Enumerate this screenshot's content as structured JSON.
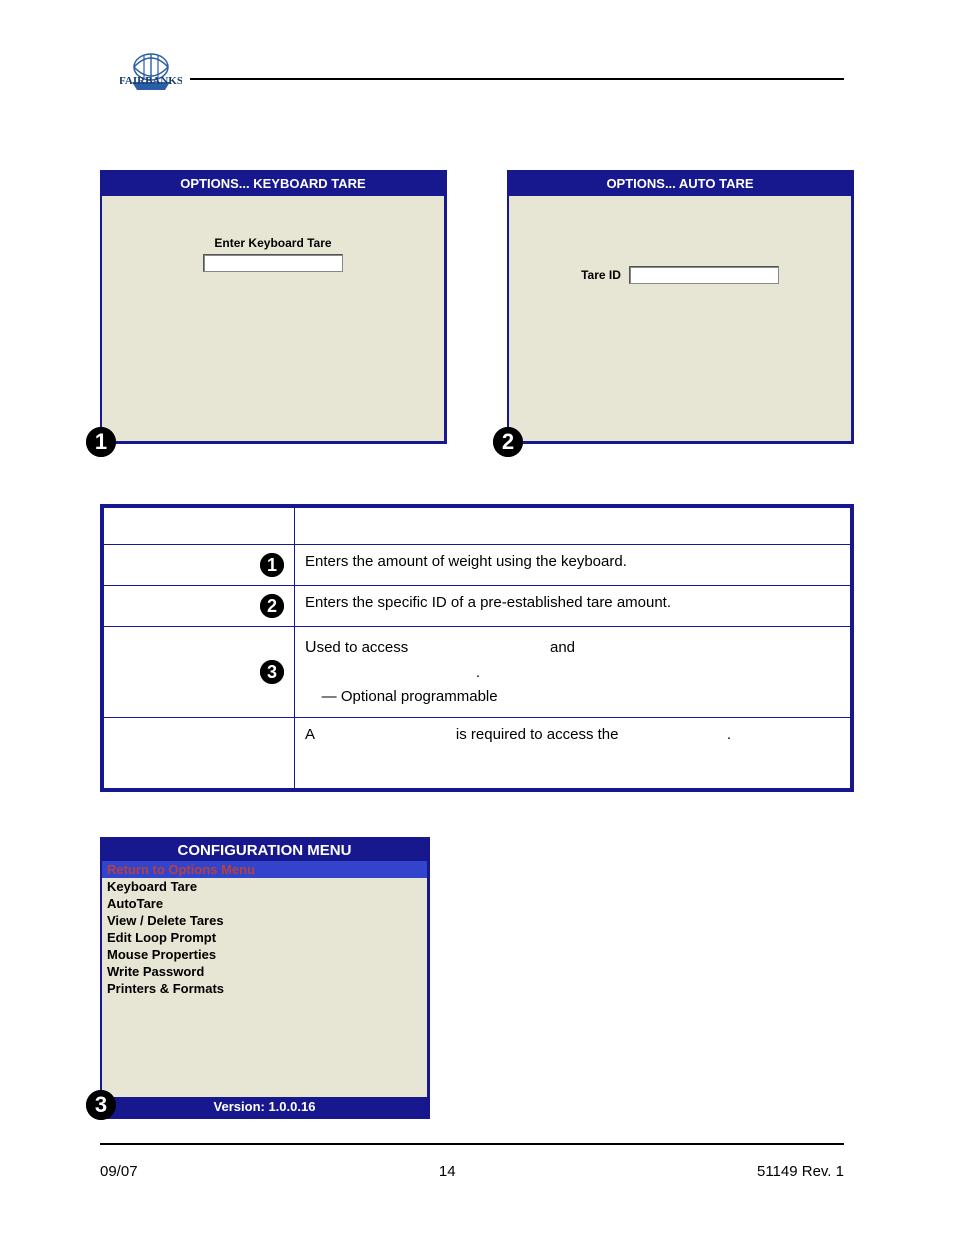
{
  "logo_text": "FAIRBANKS",
  "top_rule": true,
  "panel_left": {
    "title": "OPTIONS...  KEYBOARD TARE",
    "label": "Enter Keyboard Tare",
    "badge": "1"
  },
  "panel_right": {
    "title": "OPTIONS...  AUTO TARE",
    "label": "Tare ID",
    "badge": "2"
  },
  "table_rows": [
    {
      "badge": "1",
      "text": "Enters the amount of weight using the keyboard."
    },
    {
      "badge": "2",
      "text": "Enters the specific ID of a pre-established tare amount."
    },
    {
      "badge": "3",
      "line1a": "Used to access",
      "line1b": "and",
      "line1c": ".",
      "line2": "—   Optional programmable"
    },
    {
      "line_a": "A",
      "line_b": "is required to access the",
      "line_c": "."
    }
  ],
  "config": {
    "title": "CONFIGURATION MENU",
    "items": [
      "Return to Options Menu",
      "Keyboard Tare",
      "AutoTare",
      "View / Delete Tares",
      "Edit Loop Prompt",
      "Mouse Properties",
      "Write Password",
      "Printers & Formats"
    ],
    "selected_index": 0,
    "version": "Version: 1.0.0.16",
    "badge": "3"
  },
  "footer": {
    "left": "09/07",
    "center": "14",
    "right": "51149   Rev. 1"
  }
}
